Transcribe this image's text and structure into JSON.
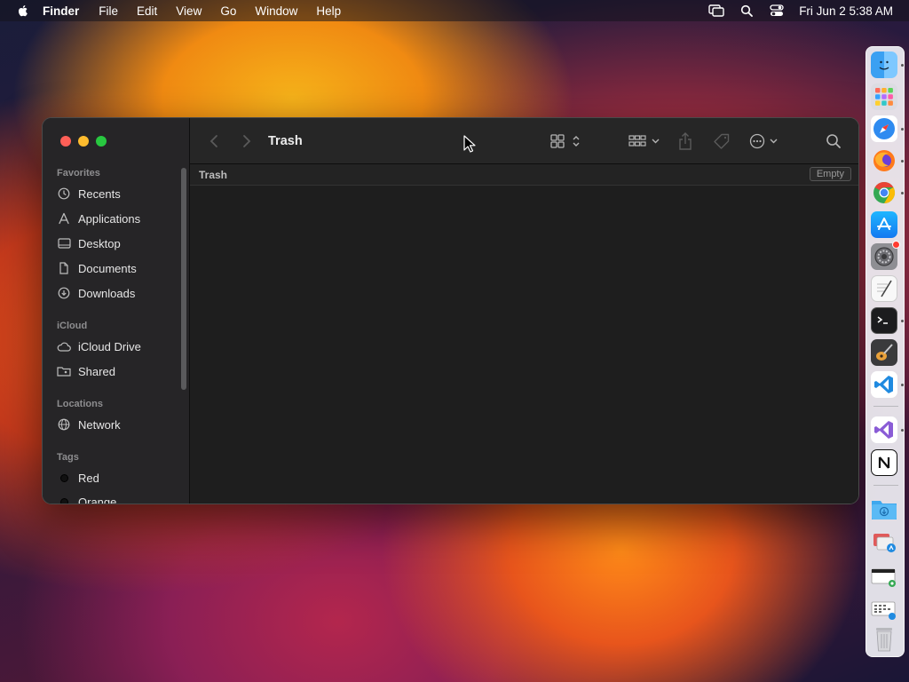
{
  "menubar": {
    "app_name": "Finder",
    "menus": [
      "File",
      "Edit",
      "View",
      "Go",
      "Window",
      "Help"
    ],
    "clock": "Fri Jun 2  5:38 AM"
  },
  "window": {
    "title": "Trash",
    "path_label": "Trash",
    "empty_button": "Empty"
  },
  "sidebar": {
    "favorites_title": "Favorites",
    "favorites": [
      "Recents",
      "Applications",
      "Desktop",
      "Documents",
      "Downloads"
    ],
    "icloud_title": "iCloud",
    "icloud": [
      "iCloud Drive",
      "Shared"
    ],
    "locations_title": "Locations",
    "locations": [
      "Network"
    ],
    "tags_title": "Tags",
    "tags": [
      "Red",
      "Orange"
    ]
  },
  "dock": {
    "apps": [
      "finder-icon",
      "launchpad-icon",
      "safari-icon",
      "firefox-icon",
      "chrome-icon",
      "app-store-icon",
      "system-settings-icon",
      "textedit-icon",
      "terminal-icon",
      "garageband-icon",
      "vscode-icon",
      "visual-studio-icon",
      "notion-icon"
    ],
    "folders": [
      "downloads-folder-icon",
      "applications-stack-icon",
      "documents-stack-icon",
      "screenshots-stack-icon",
      "trash-icon"
    ]
  }
}
